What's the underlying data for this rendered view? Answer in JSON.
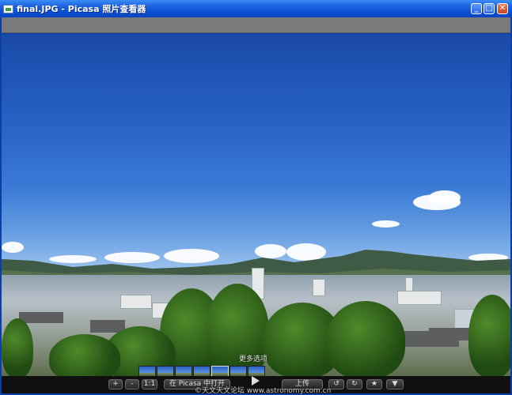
{
  "window": {
    "title": "final.JPG - Picasa 照片查看器",
    "controls": {
      "minimize": "_",
      "maximize": "□",
      "close": "✕"
    }
  },
  "photo": {
    "icon": "landscape-photo"
  },
  "overlay": {
    "more_options": "更多选项"
  },
  "toolbar": {
    "zoom_in": "+",
    "zoom_out": "-",
    "actual_size": "1:1",
    "open_in_picasa": "在 Picasa 中打开",
    "upload": "上传",
    "rotate_left": "↺",
    "rotate_right": "↻",
    "star": "★",
    "more": "▼"
  },
  "watermark": "©天文天文论坛 www.astronomy.com.cn",
  "colors": {
    "titlebar": "#0a4fd1",
    "toolbar_bg": "#101010",
    "sky": "#2660c2"
  }
}
